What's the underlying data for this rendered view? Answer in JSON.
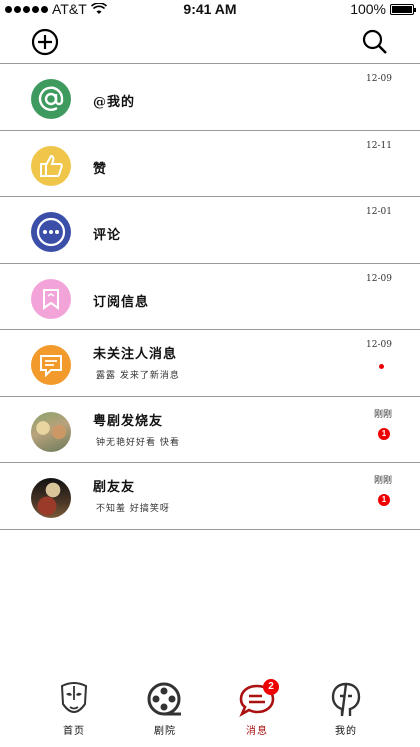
{
  "status_bar": {
    "carrier": "AT&T",
    "time": "9:41 AM",
    "battery": "100%",
    "battery_level": 1.0
  },
  "header": {
    "add_icon": "plus-circle-icon",
    "search_icon": "search-icon"
  },
  "messages": [
    {
      "title": "@我的",
      "subtitle": "",
      "time": "12-09",
      "icon": "at-icon",
      "color": "#3f9a5f"
    },
    {
      "title": "赞",
      "subtitle": "",
      "time": "12-11",
      "icon": "thumbs-up-icon",
      "color": "#f0c64a"
    },
    {
      "title": "评论",
      "subtitle": "",
      "time": "12-01",
      "icon": "more-dots-icon",
      "color": "#3b4fa8"
    },
    {
      "title": "订阅信息",
      "subtitle": "",
      "time": "12-09",
      "icon": "bookmark-icon",
      "color": "#f2a3d8"
    },
    {
      "title": "未关注人消息",
      "subtitle": "露露  发来了新消息",
      "time": "12-09",
      "icon": "message-icon",
      "color": "#f39a2c",
      "unread_dot": true
    },
    {
      "title": "粤剧发烧友",
      "subtitle": "钟无艳好好看  快看",
      "time": "刚刚",
      "icon": "user-photo",
      "badge": "1"
    },
    {
      "title": "剧友友",
      "subtitle": "不知羞  好搞笑呀",
      "time": "刚刚",
      "icon": "user-photo",
      "badge": "1"
    }
  ],
  "tabs": [
    {
      "label": "首页",
      "icon": "opera-mask-icon",
      "active": false
    },
    {
      "label": "剧院",
      "icon": "film-reel-icon",
      "active": false
    },
    {
      "label": "消息",
      "icon": "chat-bubble-icon",
      "active": true,
      "badge": "2"
    },
    {
      "label": "我的",
      "icon": "profile-icon",
      "active": false
    }
  ],
  "colors": {
    "accent": "#a11111",
    "badge": "#ee0000",
    "divider": "#999999"
  }
}
